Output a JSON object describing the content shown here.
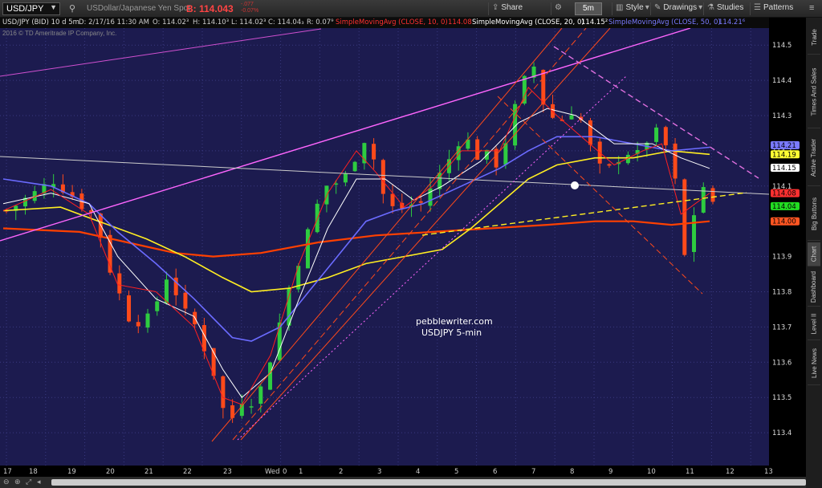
{
  "toolbar": {
    "symbol": "USD/JPY",
    "description": "USDollar/Japanese Yen Spot",
    "last_price": "B: 114.043",
    "change_line1": "-.077",
    "change_line2": "-0.07%",
    "share": "Share",
    "period": "5m",
    "style": "Style",
    "drawings": "Drawings",
    "studies": "Studies",
    "patterns": "Patterns"
  },
  "infobar": {
    "instrument": "USD/JPY (BID) 10 d 5m",
    "date": "D: 2/17/16 11:30 AM",
    "open": "O: 114.02³",
    "high": "H: 114.10³",
    "low": "L: 114.02³",
    "close": "C: 114.04₃",
    "range": "R: 0.07⁹",
    "sma10": "SimpleMovingAvg (CLOSE, 10, 0)",
    "sma10_val": "114.08",
    "sma20": "SimpleMovingAvg (CLOSE, 20, 0)",
    "sma20_val": "114.15²",
    "sma50": "SimpleMovingAvg (CLOSE, 50, 0)",
    "sma50_val": "114.21⁶"
  },
  "copyright": "2016 © TD Ameritrade IP Company, Inc.",
  "annotation": {
    "line1": "pebblewriter.com",
    "line2": "USDJPY 5-min"
  },
  "price_axis": {
    "ticks": [
      "114.5",
      "114.4",
      "114.3",
      "114.2",
      "114.1",
      "113.9",
      "113.8",
      "113.7",
      "113.6",
      "113.5",
      "113.4"
    ],
    "tick_values": [
      114.5,
      114.4,
      114.3,
      114.2,
      114.1,
      113.9,
      113.8,
      113.7,
      113.6,
      113.5,
      113.4
    ],
    "bubbles": [
      {
        "label": "114.21",
        "value": 114.216,
        "color": "#7a7aff",
        "text": "#000"
      },
      {
        "label": "114.19",
        "value": 114.19,
        "color": "#ffff33",
        "text": "#000"
      },
      {
        "label": "114.15",
        "value": 114.152,
        "color": "#ffffff",
        "text": "#000"
      },
      {
        "label": "114.08",
        "value": 114.08,
        "color": "#ff3030",
        "text": "#000"
      },
      {
        "label": "114.04",
        "value": 114.043,
        "color": "#22dd22",
        "text": "#000"
      },
      {
        "label": "114.00",
        "value": 114.0,
        "color": "#ff5522",
        "text": "#000"
      }
    ]
  },
  "time_axis": {
    "labels": [
      "17",
      "18",
      "19",
      "20",
      "21",
      "22",
      "23",
      "Wed",
      "0",
      "1",
      "2",
      "3",
      "4",
      "5",
      "6",
      "7",
      "8",
      "9",
      "10",
      "11",
      "12",
      "13"
    ]
  },
  "sidebar_tabs": [
    "Trade",
    "Times And Sales",
    "Active Trader",
    "Big Buttons",
    "Chart",
    "Dashboard",
    "Level II",
    "Live News"
  ],
  "colors": {
    "chart_bg": "#1c1b4f",
    "up_candle": "#2ecc40",
    "down_candle": "#ff4a1a",
    "sma10": "#ff2020",
    "sma20": "#ffffff",
    "sma50": "#6b6bff",
    "sma100": "#ffee22",
    "sma200": "#ff4000"
  },
  "chart_data": {
    "type": "candlestick",
    "ylim": [
      113.35,
      114.55
    ],
    "x_labels": [
      "17",
      "18",
      "19",
      "20",
      "21",
      "22",
      "23",
      "Wed",
      "0",
      "1",
      "2",
      "3",
      "4",
      "5",
      "6",
      "7",
      "8",
      "9",
      "10",
      "11",
      "12",
      "13"
    ],
    "price_path": [
      [
        0,
        114.03
      ],
      [
        3,
        114.08
      ],
      [
        5,
        114.12
      ],
      [
        7,
        114.07
      ],
      [
        9,
        114.02
      ],
      [
        10,
        113.95
      ],
      [
        11,
        113.85
      ],
      [
        12,
        113.78
      ],
      [
        13,
        113.72
      ],
      [
        15,
        113.72
      ],
      [
        17,
        113.86
      ],
      [
        18,
        113.78
      ],
      [
        19,
        113.72
      ],
      [
        20,
        113.7
      ],
      [
        21,
        113.62
      ],
      [
        22,
        113.55
      ],
      [
        23,
        113.43
      ],
      [
        24,
        113.45
      ],
      [
        25,
        113.52
      ],
      [
        26,
        113.48
      ],
      [
        27,
        113.55
      ],
      [
        28,
        113.65
      ],
      [
        29,
        113.75
      ],
      [
        30,
        113.85
      ],
      [
        31,
        113.92
      ],
      [
        32,
        114.0
      ],
      [
        33,
        114.08
      ],
      [
        34,
        114.12
      ],
      [
        35,
        114.1
      ],
      [
        36,
        114.15
      ],
      [
        37,
        114.22
      ],
      [
        38,
        114.25
      ],
      [
        39,
        114.1
      ],
      [
        40,
        114.05
      ],
      [
        41,
        114.02
      ],
      [
        42,
        114.06
      ],
      [
        43,
        114.03
      ],
      [
        44,
        114.08
      ],
      [
        45,
        114.12
      ],
      [
        46,
        114.15
      ],
      [
        47,
        114.22
      ],
      [
        48,
        114.25
      ],
      [
        49,
        114.18
      ],
      [
        50,
        114.2
      ],
      [
        51,
        114.15
      ],
      [
        52,
        114.2
      ],
      [
        53,
        114.3
      ],
      [
        54,
        114.37
      ],
      [
        55,
        114.47
      ],
      [
        56,
        114.35
      ],
      [
        57,
        114.3
      ],
      [
        58,
        114.28
      ],
      [
        59,
        114.32
      ],
      [
        60,
        114.3
      ],
      [
        61,
        114.22
      ],
      [
        62,
        114.15
      ],
      [
        63,
        114.14
      ],
      [
        64,
        114.18
      ],
      [
        65,
        114.2
      ],
      [
        66,
        114.18
      ],
      [
        67,
        114.23
      ],
      [
        68,
        114.25
      ],
      [
        69,
        114.22
      ],
      [
        70,
        114.12
      ],
      [
        71,
        113.9
      ],
      [
        71.5,
        113.9
      ],
      [
        72,
        114.02
      ],
      [
        73,
        114.1
      ],
      [
        74,
        114.04
      ]
    ],
    "sma10": [
      [
        0,
        114.03
      ],
      [
        5,
        114.09
      ],
      [
        9,
        114.02
      ],
      [
        12,
        113.82
      ],
      [
        16,
        113.8
      ],
      [
        20,
        113.7
      ],
      [
        23,
        113.5
      ],
      [
        25,
        113.48
      ],
      [
        28,
        113.62
      ],
      [
        31,
        113.88
      ],
      [
        34,
        114.08
      ],
      [
        37,
        114.2
      ],
      [
        39,
        114.14
      ],
      [
        42,
        114.04
      ],
      [
        45,
        114.1
      ],
      [
        48,
        114.2
      ],
      [
        52,
        114.2
      ],
      [
        55,
        114.38
      ],
      [
        58,
        114.3
      ],
      [
        61,
        114.23
      ],
      [
        64,
        114.16
      ],
      [
        67,
        114.2
      ],
      [
        69,
        114.22
      ],
      [
        71,
        114.02
      ],
      [
        74,
        114.08
      ]
    ],
    "sma20": [
      [
        0,
        114.05
      ],
      [
        5,
        114.08
      ],
      [
        9,
        114.05
      ],
      [
        12,
        113.9
      ],
      [
        16,
        113.78
      ],
      [
        20,
        113.73
      ],
      [
        23,
        113.58
      ],
      [
        25,
        113.5
      ],
      [
        28,
        113.57
      ],
      [
        31,
        113.78
      ],
      [
        34,
        113.98
      ],
      [
        37,
        114.12
      ],
      [
        40,
        114.12
      ],
      [
        43,
        114.06
      ],
      [
        46,
        114.1
      ],
      [
        50,
        114.17
      ],
      [
        54,
        114.28
      ],
      [
        57,
        114.32
      ],
      [
        60,
        114.3
      ],
      [
        64,
        114.22
      ],
      [
        68,
        114.22
      ],
      [
        71,
        114.18
      ],
      [
        74,
        114.15
      ]
    ],
    "sma50": [
      [
        0,
        114.12
      ],
      [
        5,
        114.1
      ],
      [
        9,
        114.05
      ],
      [
        12,
        113.97
      ],
      [
        16,
        113.88
      ],
      [
        20,
        113.78
      ],
      [
        24,
        113.67
      ],
      [
        26,
        113.66
      ],
      [
        29,
        113.7
      ],
      [
        32,
        113.8
      ],
      [
        35,
        113.9
      ],
      [
        38,
        114.0
      ],
      [
        41,
        114.03
      ],
      [
        44,
        114.05
      ],
      [
        48,
        114.1
      ],
      [
        52,
        114.15
      ],
      [
        55,
        114.2
      ],
      [
        58,
        114.24
      ],
      [
        62,
        114.24
      ],
      [
        66,
        114.22
      ],
      [
        70,
        114.2
      ],
      [
        74,
        114.21
      ]
    ],
    "sma100": [
      [
        0,
        114.03
      ],
      [
        6,
        114.04
      ],
      [
        10,
        114.0
      ],
      [
        15,
        113.95
      ],
      [
        19,
        113.9
      ],
      [
        23,
        113.84
      ],
      [
        26,
        113.8
      ],
      [
        30,
        113.81
      ],
      [
        34,
        113.84
      ],
      [
        38,
        113.88
      ],
      [
        42,
        113.9
      ],
      [
        46,
        113.92
      ],
      [
        49,
        113.98
      ],
      [
        52,
        114.05
      ],
      [
        55,
        114.12
      ],
      [
        58,
        114.16
      ],
      [
        62,
        114.18
      ],
      [
        66,
        114.18
      ],
      [
        70,
        114.2
      ],
      [
        74,
        114.19
      ]
    ],
    "sma200": [
      [
        0,
        113.98
      ],
      [
        8,
        113.97
      ],
      [
        13,
        113.94
      ],
      [
        18,
        113.91
      ],
      [
        22,
        113.9
      ],
      [
        27,
        113.91
      ],
      [
        33,
        113.94
      ],
      [
        39,
        113.96
      ],
      [
        45,
        113.97
      ],
      [
        51,
        113.98
      ],
      [
        57,
        113.99
      ],
      [
        62,
        114.0
      ],
      [
        66,
        114.0
      ],
      [
        70,
        113.99
      ],
      [
        74,
        114.0
      ]
    ]
  }
}
